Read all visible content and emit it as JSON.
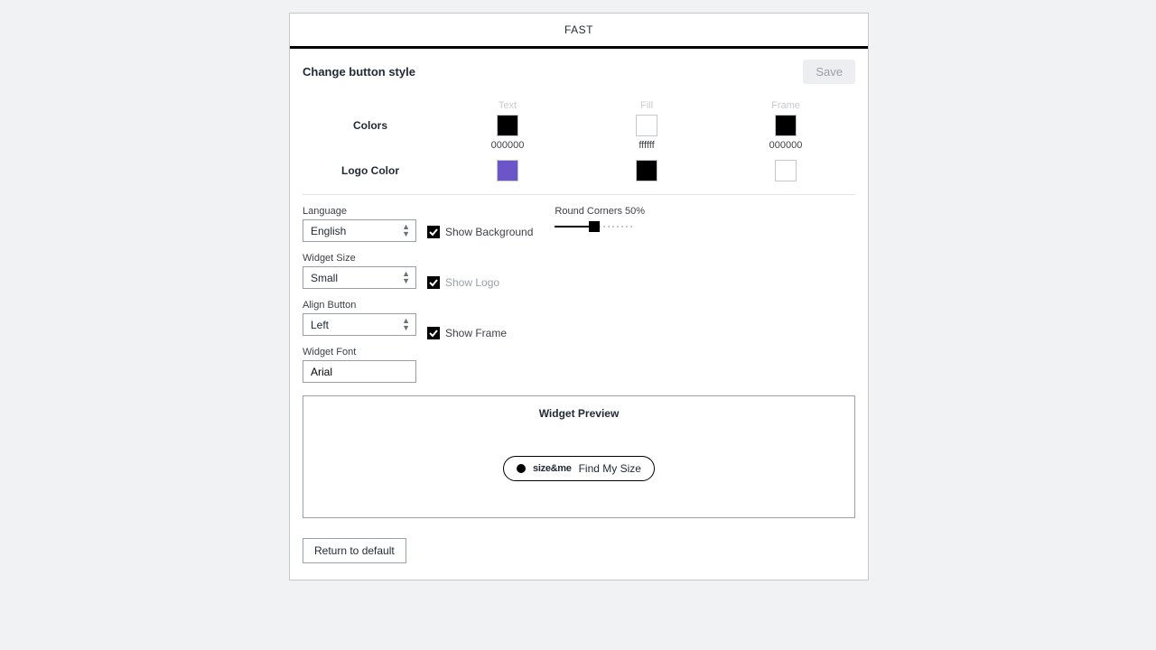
{
  "tab": {
    "label": "FAST"
  },
  "header": {
    "title": "Change button style",
    "save_label": "Save"
  },
  "colors": {
    "label": "Colors",
    "text": {
      "title": "Text",
      "hex": "000000",
      "swatch": "#000000"
    },
    "fill": {
      "title": "Fill",
      "hex": "ffffff",
      "swatch": "#ffffff"
    },
    "frame": {
      "title": "Frame",
      "hex": "000000",
      "swatch": "#000000"
    }
  },
  "logo_color": {
    "label": "Logo Color",
    "swatches": [
      "#6c55c8",
      "#000000",
      "#ffffff"
    ]
  },
  "language": {
    "label": "Language",
    "value": "English"
  },
  "widget_size": {
    "label": "Widget Size",
    "value": "Small"
  },
  "align": {
    "label": "Align Button",
    "value": "Left"
  },
  "font": {
    "label": "Widget Font",
    "value": "Arial"
  },
  "show_background": {
    "label": "Show Background",
    "checked": true
  },
  "show_logo": {
    "label": "Show Logo",
    "checked": true
  },
  "show_frame": {
    "label": "Show Frame",
    "checked": true
  },
  "round_corners": {
    "label": "Round Corners 50%",
    "percent": 50
  },
  "preview": {
    "title": "Widget Preview",
    "logo_text": "size&me",
    "button_label": "Find My Size"
  },
  "return_label": "Return to default"
}
